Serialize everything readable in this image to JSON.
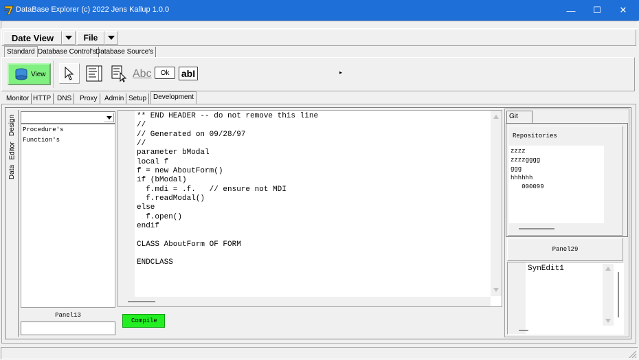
{
  "window": {
    "title": "DataBase Explorer (c) 2022 Jens Kallup 1.0.0",
    "minimize": "—",
    "maximize": "☐",
    "close": "✕"
  },
  "menubar": {
    "date_view": "Date View",
    "file": "File"
  },
  "toolbar_tabs": [
    "Standard",
    "Database Control's",
    "Database Source's"
  ],
  "palette": {
    "view_label": "View",
    "label_abc": "Abc",
    "button_ok": "Ok",
    "edit_ab": "abI",
    "scroll_right": "▸"
  },
  "main_tabs": [
    "Monitor",
    "HTTP",
    "DNS",
    "Proxy",
    "Admin",
    "Setup",
    "Development"
  ],
  "side_tabs": [
    "Design",
    "Editor",
    "Data"
  ],
  "left_panel": {
    "dropdown_value": "",
    "items": [
      "Procedure's",
      "Function's"
    ],
    "panel_label": "Panel13",
    "input_value": ""
  },
  "editor": {
    "lines": [
      "** END HEADER -- do not remove this line",
      "//",
      "// Generated on 09/28/97",
      "//",
      "parameter bModal",
      "local f",
      "f = new AboutForm()",
      "if (bModal)",
      "  f.mdi = .f.   // ensure not MDI",
      "  f.readModal()",
      "else",
      "  f.open()",
      "endif",
      "",
      "CLASS AboutForm OF FORM",
      "",
      "ENDCLASS"
    ],
    "compile_label": "Compile"
  },
  "git_panel": {
    "tab_label": "Git",
    "repos_label": "Repositories",
    "repos": [
      "zzzz",
      "zzzzgggg",
      "ggg",
      "hhhhhh",
      "   000099"
    ],
    "panel29": "Panel29",
    "synedit": "SynEdit1"
  },
  "colors": {
    "titlebar": "#1e6fd8",
    "view_button": "#80f080",
    "compile_button": "#22ee22"
  }
}
